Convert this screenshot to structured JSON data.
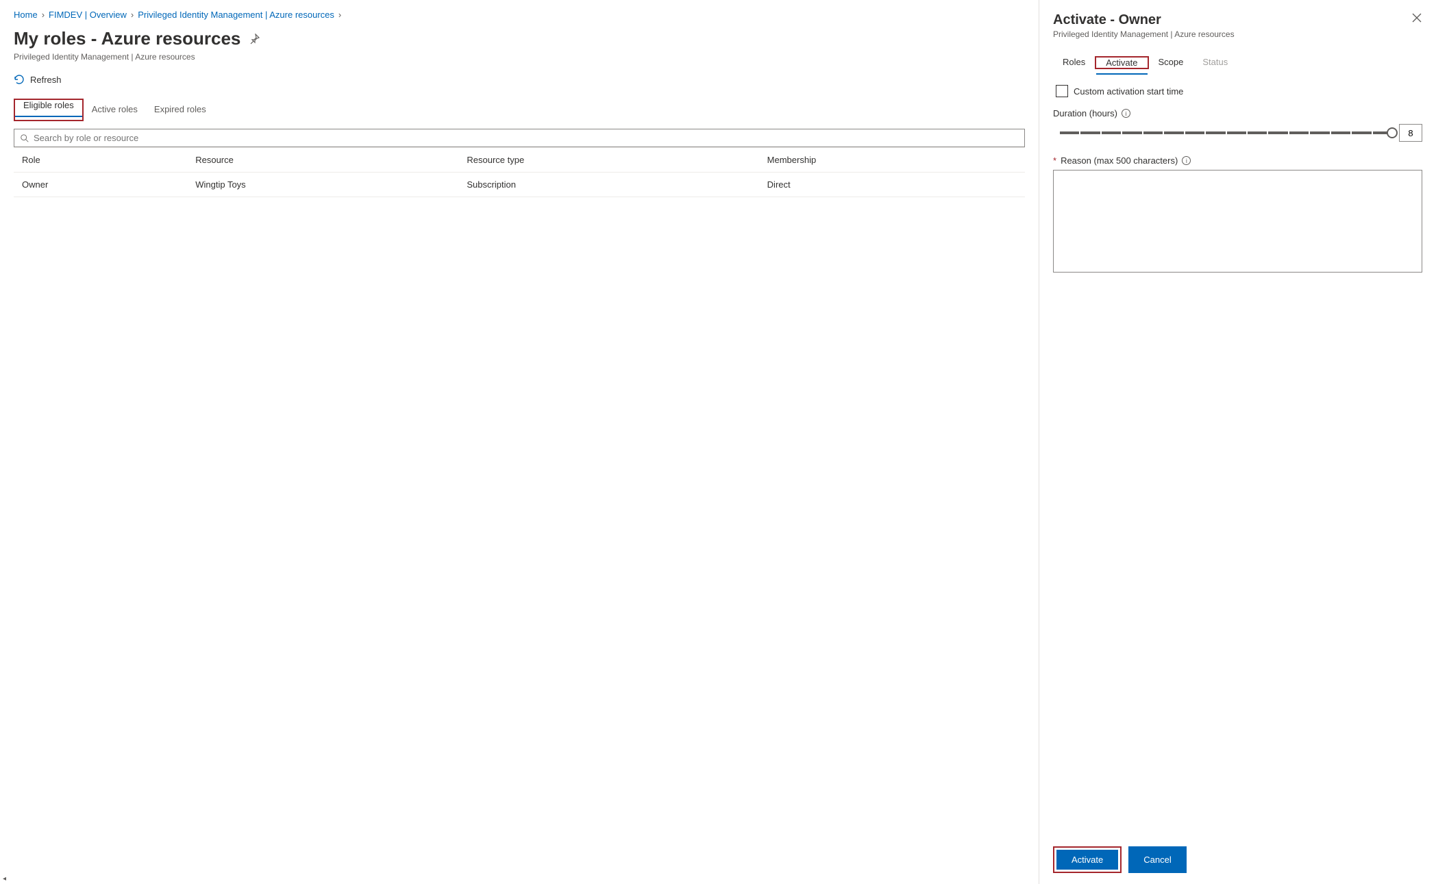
{
  "breadcrumb": {
    "home": "Home",
    "fimdev": "FIMDEV | Overview",
    "pim": "Privileged Identity Management | Azure resources"
  },
  "page": {
    "title": "My roles - Azure resources",
    "subtitle": "Privileged Identity Management | Azure resources",
    "refresh": "Refresh"
  },
  "tabs": {
    "eligible": "Eligible roles",
    "active": "Active roles",
    "expired": "Expired roles"
  },
  "search": {
    "placeholder": "Search by role or resource"
  },
  "table": {
    "headers": {
      "role": "Role",
      "resource": "Resource",
      "resource_type": "Resource type",
      "membership": "Membership"
    },
    "rows": [
      {
        "role": "Owner",
        "resource": "Wingtip Toys",
        "resource_type": "Subscription",
        "membership": "Direct"
      }
    ]
  },
  "panel": {
    "title": "Activate - Owner",
    "subtitle": "Privileged Identity Management | Azure resources",
    "tabs": {
      "roles": "Roles",
      "activate": "Activate",
      "scope": "Scope",
      "status": "Status"
    },
    "custom_start": "Custom activation start time",
    "duration_label": "Duration (hours)",
    "duration_value": "8",
    "reason_label": "Reason (max 500 characters)",
    "buttons": {
      "activate": "Activate",
      "cancel": "Cancel"
    }
  }
}
